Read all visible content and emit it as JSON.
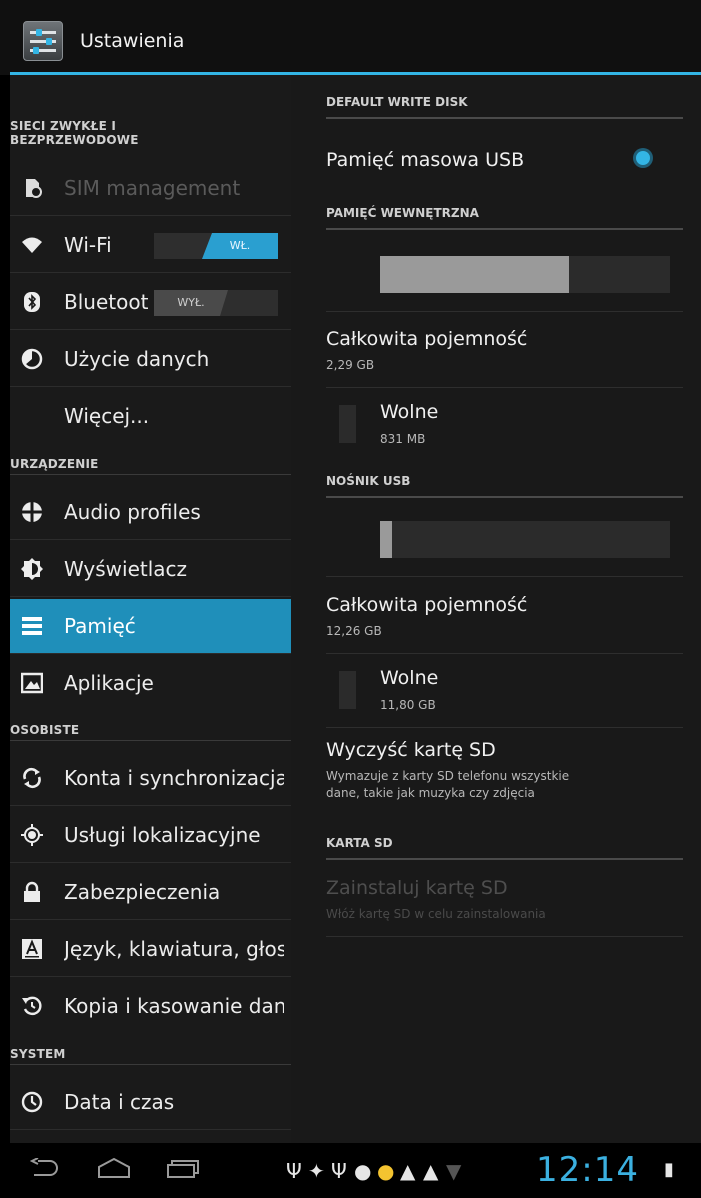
{
  "app": {
    "title": "Ustawienia"
  },
  "left_pane": {
    "sections": [
      {
        "header": "SIECI ZWYKŁE I\nBEZPRZEWODOWE"
      },
      {
        "header": "URZĄDZENIE"
      },
      {
        "header": "OSOBISTE"
      },
      {
        "header": "SYSTEM"
      }
    ],
    "items": [
      {
        "label": "SIM management",
        "icon": "sim-icon",
        "disabled": true
      },
      {
        "label": "Wi-Fi",
        "icon": "wifi-icon",
        "switch": "WŁ.",
        "state": "on"
      },
      {
        "label": "Bluetooth",
        "icon": "bluetooth-icon",
        "switch": "WYŁ.",
        "state": "off"
      },
      {
        "label": "Użycie danych",
        "icon": "data-usage-icon"
      },
      {
        "label": "Więcej...",
        "icon": ""
      },
      {
        "label": "Audio profiles",
        "icon": "audio-profiles-icon"
      },
      {
        "label": "Wyświetlacz",
        "icon": "display-icon"
      },
      {
        "label": "Pamięć",
        "icon": "storage-icon",
        "selected": true
      },
      {
        "label": "Aplikacje",
        "icon": "apps-icon"
      },
      {
        "label": "Konta i synchronizacja",
        "icon": "sync-icon"
      },
      {
        "label": "Usługi lokalizacyjne",
        "icon": "location-icon"
      },
      {
        "label": "Zabezpieczenia",
        "icon": "lock-icon"
      },
      {
        "label": "Język, klawiatura, głos",
        "icon": "language-icon"
      },
      {
        "label": "Kopia i kasowanie danych",
        "icon": "backup-icon"
      },
      {
        "label": "Data i czas",
        "icon": "clock-icon"
      }
    ]
  },
  "right_pane": {
    "default_write_disk": {
      "header": "DEFAULT WRITE DISK",
      "option": "Pamięć masowa USB",
      "selected": true
    },
    "internal": {
      "header": "PAMIĘĆ WEWNĘTRZNA",
      "used_fraction": 0.65,
      "total_label": "Całkowita pojemność",
      "total_value": "2,29 GB",
      "free_label": "Wolne",
      "free_value": "831 MB"
    },
    "usb": {
      "header": "NOŚNIK USB",
      "used_fraction": 0.04,
      "total_label": "Całkowita pojemność",
      "total_value": "12,26 GB",
      "free_label": "Wolne",
      "free_value": "11,80 GB"
    },
    "erase": {
      "title": "Wyczyść kartę SD",
      "desc_line1": "Wymazuje z karty SD telefonu wszystkie",
      "desc_line2": "dane, takie jak muzyka czy zdjęcia"
    },
    "sd_card": {
      "header": "KARTA SD",
      "title": "Zainstaluj kartę SD",
      "desc": "Włóż kartę SD w celu zainstalowania"
    }
  },
  "navbar": {
    "clock": "12:14",
    "status_icons": [
      "usb-icon",
      "android-debug-icon",
      "usb-icon",
      "chat-icon",
      "sync-warning-icon",
      "warning-icon",
      "warning-icon",
      "wifi-signal-icon",
      "battery-icon"
    ]
  },
  "colors": {
    "accent": "#33b5e5",
    "selected": "#1f8fba"
  }
}
